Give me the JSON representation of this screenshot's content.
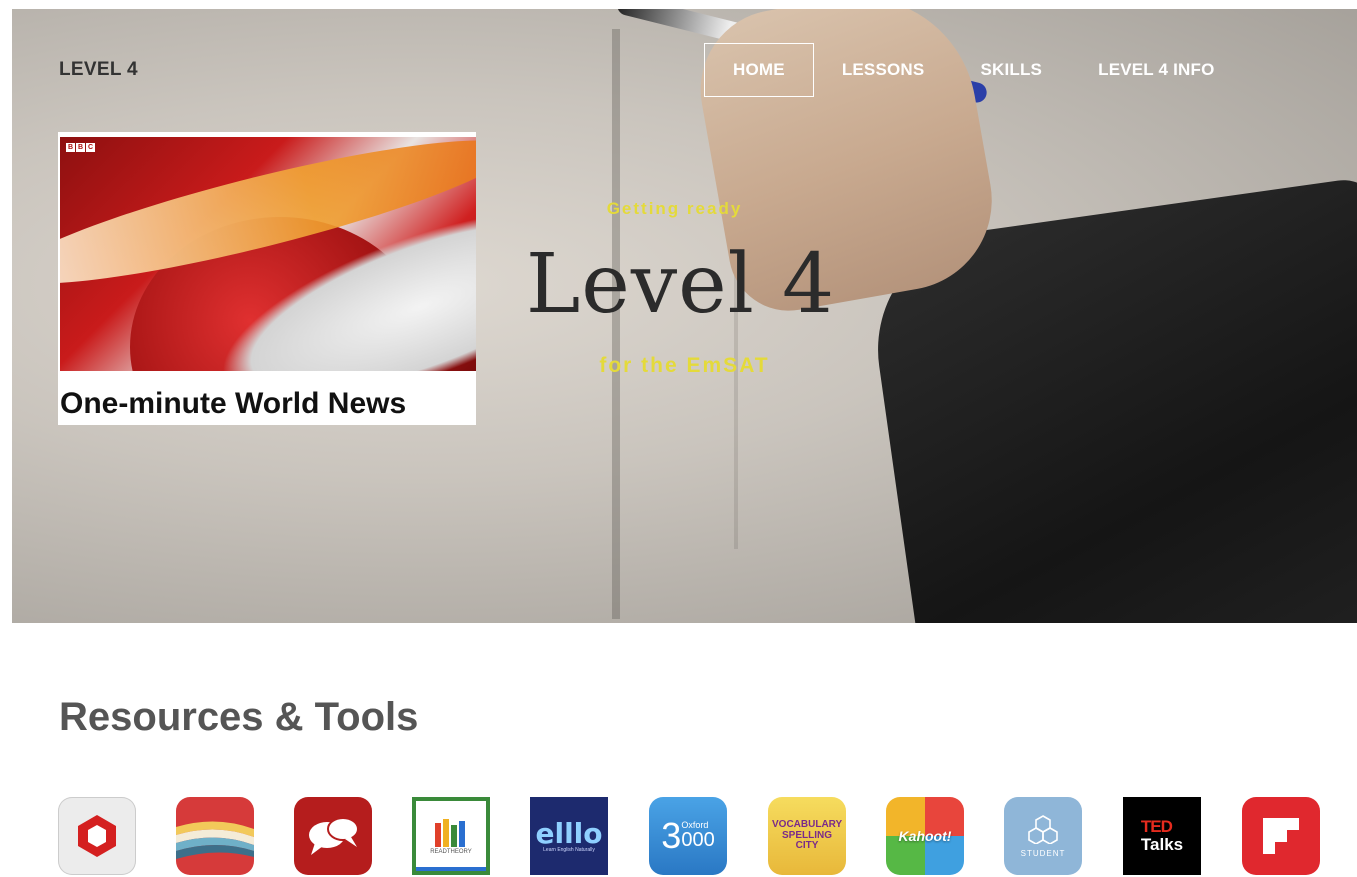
{
  "header": {
    "brand": "LEVEL 4",
    "nav": [
      {
        "label": "HOME",
        "active": true
      },
      {
        "label": "LESSONS",
        "active": false
      },
      {
        "label": "SKILLS",
        "active": false
      },
      {
        "label": "LEVEL 4 INFO",
        "active": false
      }
    ]
  },
  "hero": {
    "pre_title": "Getting ready",
    "title": "Level 4",
    "subtitle": "for the EmSAT"
  },
  "news_card": {
    "logo": [
      "B",
      "B",
      "C"
    ],
    "title": "One-minute World News"
  },
  "resources": {
    "title": "Resources & Tools",
    "tools": [
      {
        "icon": "hexagon-app-icon",
        "color": "#e8e8e8",
        "accent": "#d42020"
      },
      {
        "icon": "stripes-app-icon",
        "color": "#d63a3a"
      },
      {
        "icon": "chat-bubbles-app-icon",
        "color": "#b51d1d"
      },
      {
        "icon": "readtheory-app-icon",
        "color": "#ffffff",
        "text": "READTHEORY"
      },
      {
        "icon": "elllo-app-icon",
        "color": "#1d2a6e",
        "text": "elllo",
        "subtext": "Learn English Naturally"
      },
      {
        "icon": "oxford-3000-app-icon",
        "color": "#3a8fd6",
        "text": "3",
        "subtext": "Oxford",
        "text2": "000"
      },
      {
        "icon": "vocabulary-spelling-city-app-icon",
        "color": "#f2d04a",
        "text": "VOCABULARY SPELLING CITY"
      },
      {
        "icon": "kahoot-app-icon",
        "color": "#e8a030",
        "text": "Kahoot!"
      },
      {
        "icon": "student-app-icon",
        "color": "#8fb6d8",
        "text": "STUDENT"
      },
      {
        "icon": "ted-talks-app-icon",
        "color": "#000000",
        "text": "TED",
        "text2": "Talks"
      },
      {
        "icon": "flipboard-app-icon",
        "color": "#e0282e"
      }
    ]
  }
}
